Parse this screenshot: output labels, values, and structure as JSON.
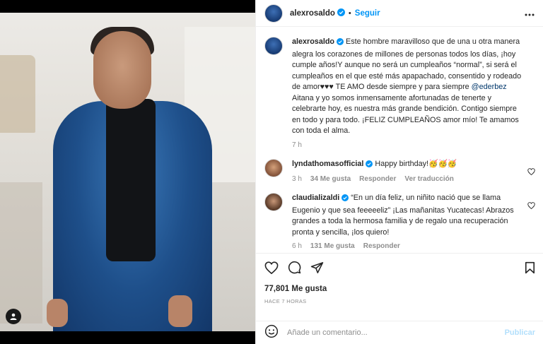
{
  "post": {
    "username": "alexrosaldo",
    "follow_label": "Seguir",
    "separator": "•",
    "caption_user": "alexrosaldo",
    "caption_part1": "Este hombre maravilloso que de una u otra manera alegra los corazones de millones de personas todos los días, ¡hoy cumple años!Y aunque no será un cumpleaños “normal”, si será el cumpleaños en el que esté más apapachado, consentido y rodeado de amor♥♥♥ TE AMO desde siempre y para siempre ",
    "caption_mention": "@ederbez",
    "caption_part2": " Aitana y yo somos inmensamente afortunadas de tenerte y celebrarte hoy, es nuestra más grande bendición. Contigo siempre en todo y para todo. ¡FELIZ CUMPLEAÑOS amor mío! Te amamos con toda el alma.",
    "caption_time": "7 h"
  },
  "comments": [
    {
      "user": "lyndathomasofficial",
      "text": "Happy birthday!🥳🥳🥳",
      "time": "3 h",
      "likes": "34 Me gusta",
      "reply": "Responder",
      "translate": "Ver traducción"
    },
    {
      "user": "claudializaldi",
      "text": "“En un día feliz, un niñito nació que se llama Eugenio y que sea feeeeeliz” ¡Las mañanitas Yucatecas! Abrazos grandes a toda la hermosa familia y de regalo una recuperación pronta y sencilla, ¡los quiero!",
      "time": "6 h",
      "likes": "131 Me gusta",
      "reply": "Responder"
    }
  ],
  "footer": {
    "likes": "77,801 Me gusta",
    "ago": "HACE 7 HORAS",
    "comment_placeholder": "Añade un comentario...",
    "publish_label": "Publicar"
  },
  "icons": {
    "heart": "heart-icon",
    "comment": "comment-icon",
    "share": "share-icon",
    "save": "bookmark-icon",
    "emoji": "emoji-icon",
    "more": "more-icon",
    "verified": "verified-badge-icon",
    "user_tag": "user-tag-icon"
  },
  "colors": {
    "accent": "#0095f6",
    "verified": "#0095f6",
    "publish_disabled": "#b2dffc"
  }
}
